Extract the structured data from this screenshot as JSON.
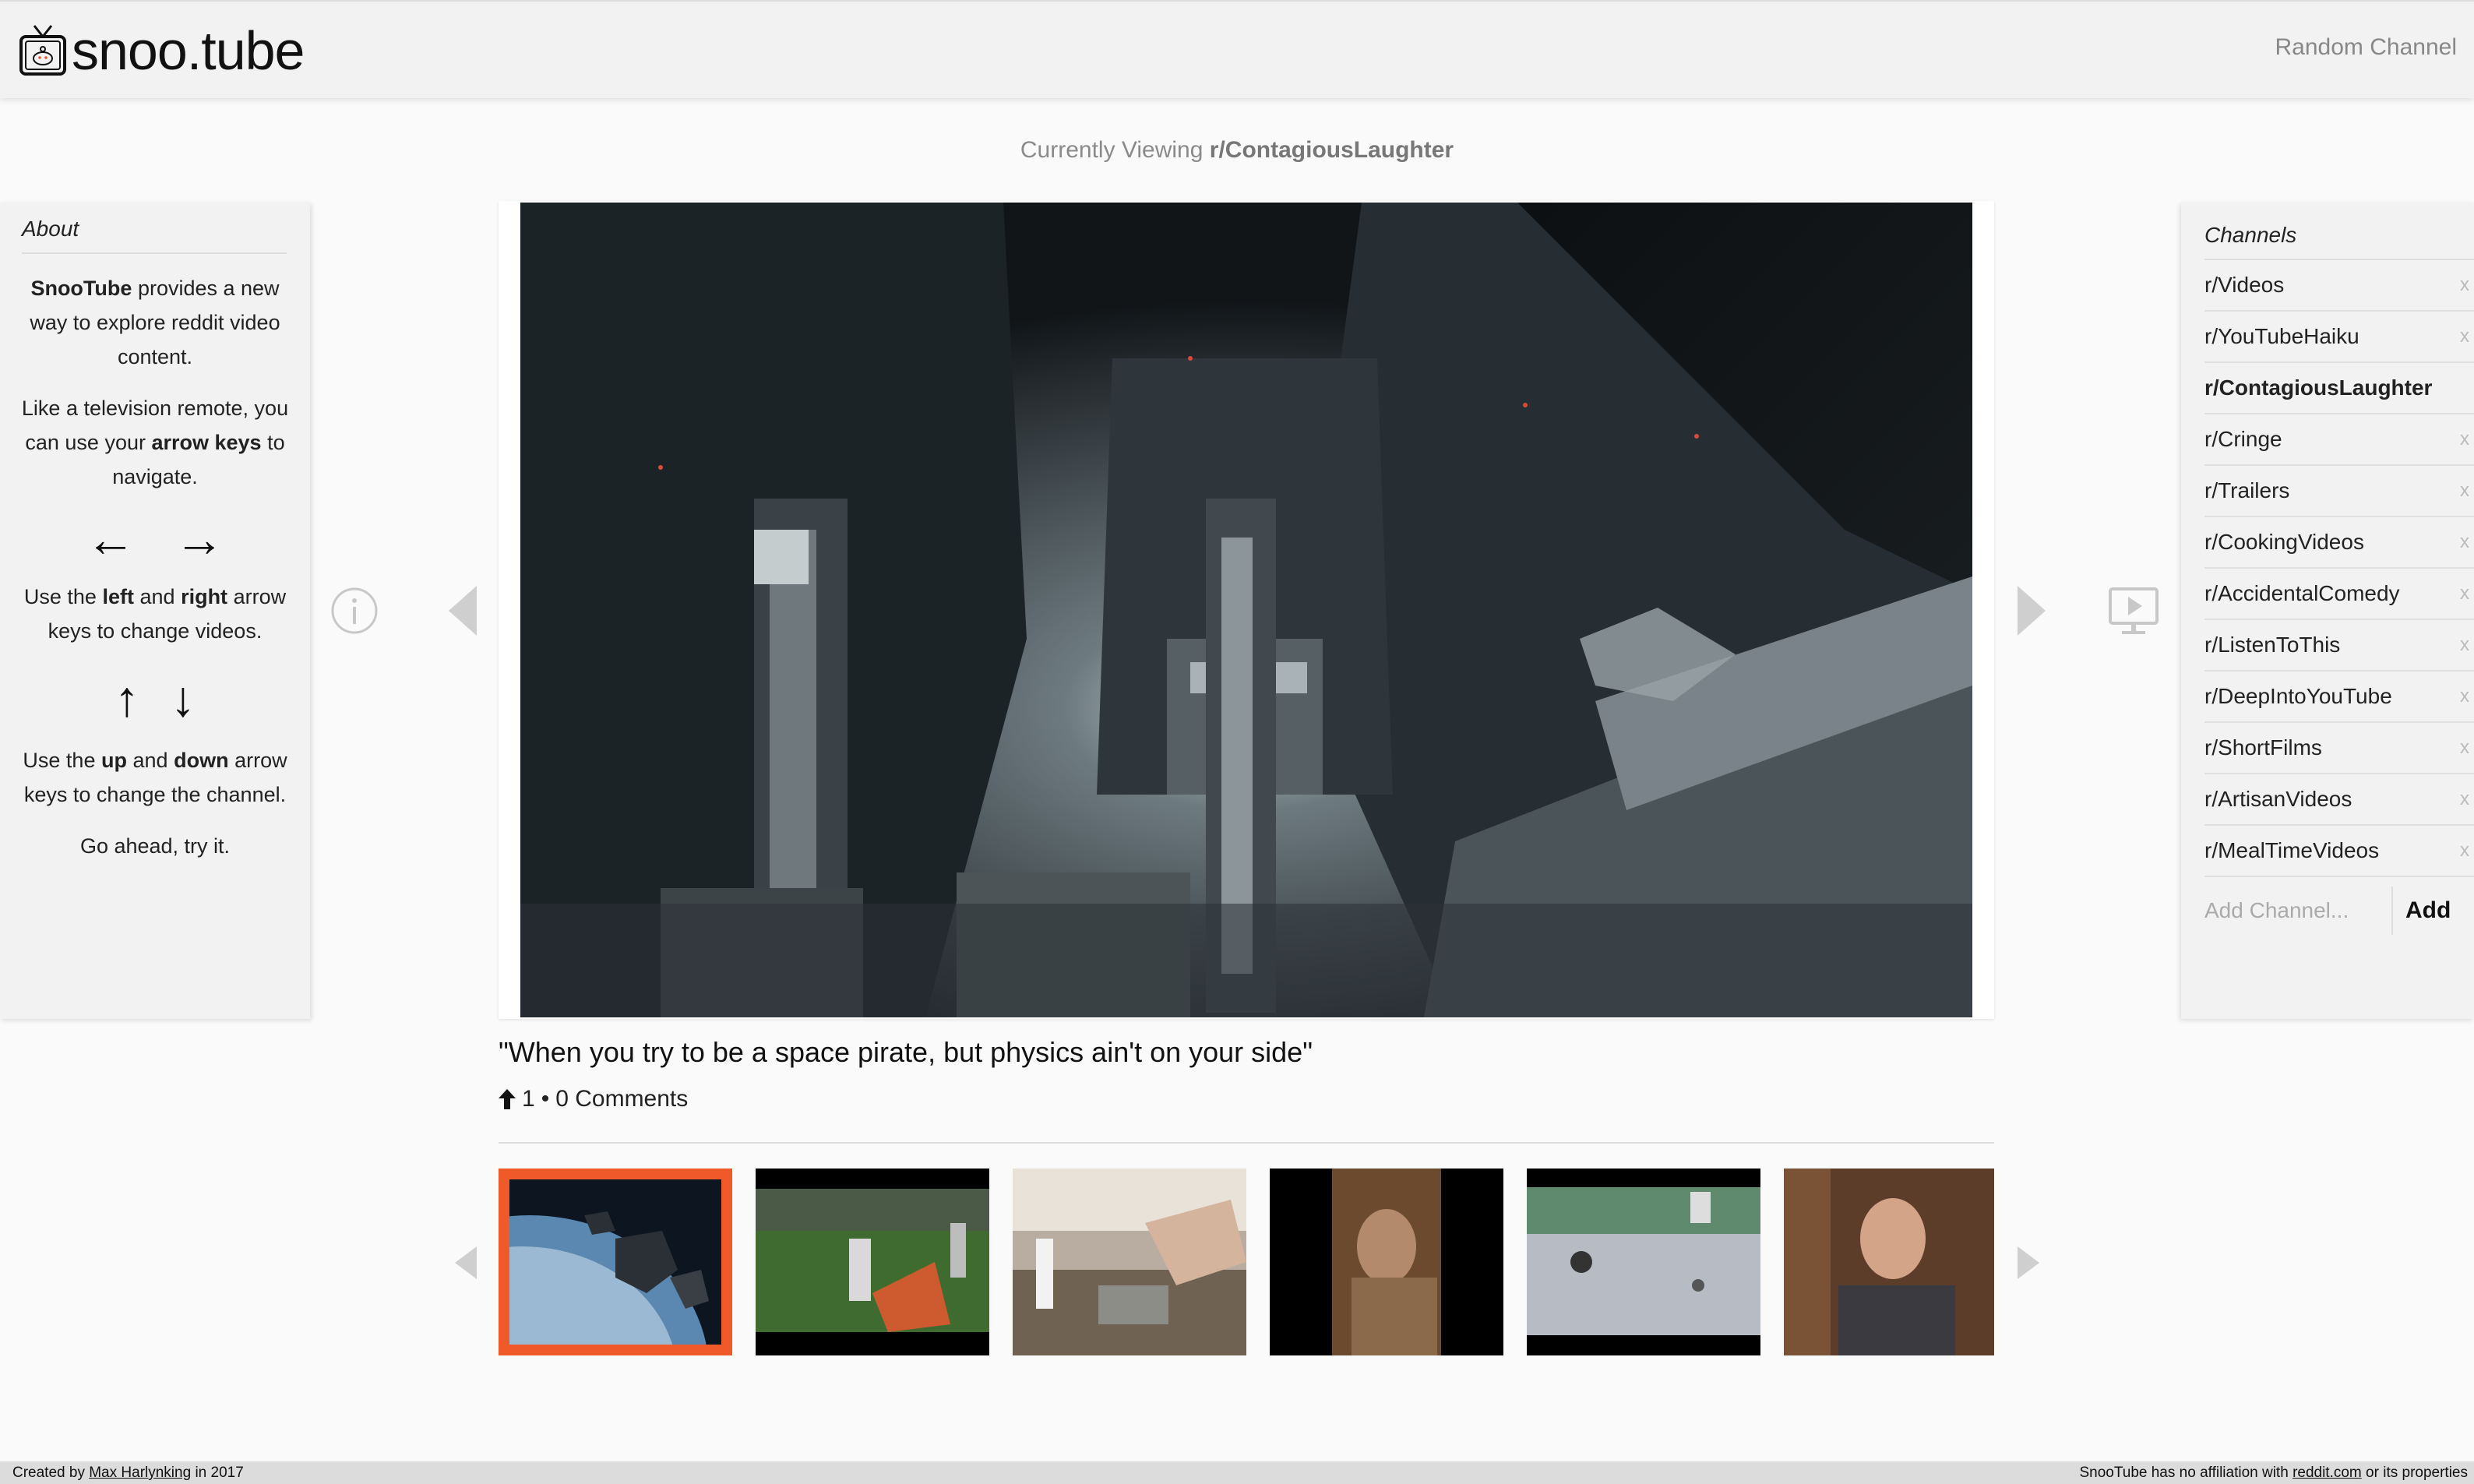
{
  "header": {
    "logo_text": "snoo.tube",
    "random_channel": "Random Channel"
  },
  "viewing": {
    "prefix": "Currently Viewing",
    "channel": "r/ContagiousLaughter"
  },
  "about": {
    "title": "About",
    "p1_brand": "SnooTube",
    "p1_rest": "provides a new way to explore reddit video content.",
    "p2_a": "Like a television remote, you can use your",
    "p2_bold": "arrow keys",
    "p2_b": "to navigate.",
    "arrows_lr": "←→",
    "p3_a": "Use the",
    "p3_left": "left",
    "p3_and": "and",
    "p3_right": "right",
    "p3_b": "arrow keys to change videos.",
    "arrows_ud": "↑↓",
    "p4_a": "Use the",
    "p4_up": "up",
    "p4_and": "and",
    "p4_down": "down",
    "p4_b": "arrow keys to change the channel.",
    "p5": "Go ahead, try it."
  },
  "icons": {
    "info": "info-icon",
    "prev": "triangle-left-icon",
    "next": "triangle-right-icon",
    "tv": "tv-play-icon",
    "upvote": "upvote-arrow-icon"
  },
  "video": {
    "title": "\"When you try to be a space pirate, but physics ain't on your side\"",
    "upvotes": "1",
    "separator": "•",
    "comments": "0 Comments"
  },
  "thumbnails": [
    {
      "label": "space debris",
      "active": true
    },
    {
      "label": "field with people",
      "active": false
    },
    {
      "label": "kitchen sink",
      "active": false
    },
    {
      "label": "man in doorway",
      "active": false
    },
    {
      "label": "birds on parking lot",
      "active": false
    },
    {
      "label": "man in suit",
      "active": false
    }
  ],
  "channels": {
    "title": "Channels",
    "items": [
      {
        "name": "r/Videos",
        "active": false
      },
      {
        "name": "r/YouTubeHaiku",
        "active": false
      },
      {
        "name": "r/ContagiousLaughter",
        "active": true
      },
      {
        "name": "r/Cringe",
        "active": false
      },
      {
        "name": "r/Trailers",
        "active": false
      },
      {
        "name": "r/CookingVideos",
        "active": false
      },
      {
        "name": "r/AccidentalComedy",
        "active": false
      },
      {
        "name": "r/ListenToThis",
        "active": false
      },
      {
        "name": "r/DeepIntoYouTube",
        "active": false
      },
      {
        "name": "r/ShortFilms",
        "active": false
      },
      {
        "name": "r/ArtisanVideos",
        "active": false
      },
      {
        "name": "r/MealTimeVideos",
        "active": false
      }
    ],
    "remove_label": "x",
    "add_placeholder": "Add Channel...",
    "add_button": "Add"
  },
  "footer": {
    "created_by": "Created by",
    "author": "Max Harlynking",
    "year": "in 2017",
    "disclaimer_a": "SnooTube has no affiliation with",
    "reddit_link": "reddit.com",
    "disclaimer_b": "or its properties"
  },
  "colors": {
    "accent_orange": "#f0592a",
    "panel_bg": "#f2f2f2",
    "page_bg": "#fafafa"
  }
}
